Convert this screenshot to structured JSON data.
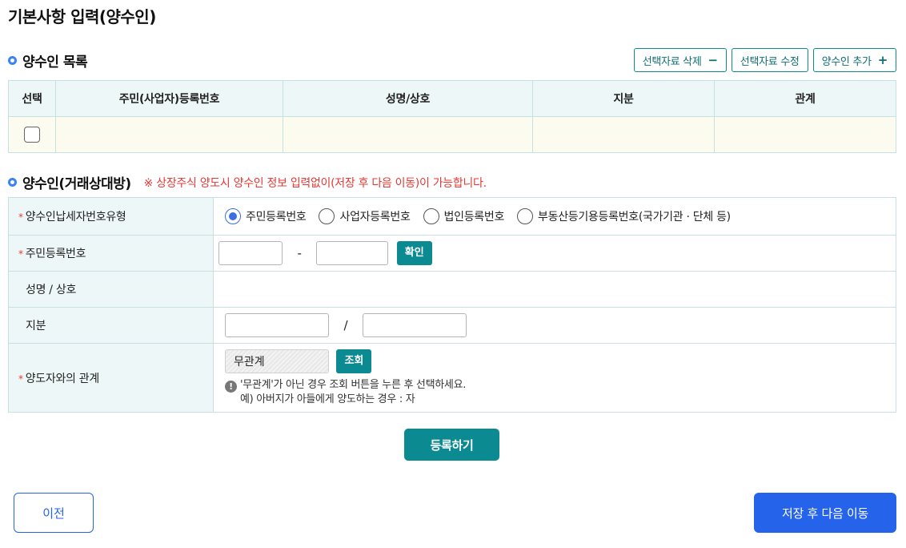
{
  "page": {
    "title": "기본사항 입력(양수인)"
  },
  "list_section": {
    "title": "양수인 목록",
    "buttons": {
      "delete_label": "선택자료 삭제",
      "delete_symbol": "−",
      "edit_label": "선택자료 수정",
      "add_label": "양수인 추가",
      "add_symbol": "+"
    },
    "columns": [
      "선택",
      "주민(사업자)등록번호",
      "성명/상호",
      "지분",
      "관계"
    ]
  },
  "detail_section": {
    "title": "양수인(거래상대방)",
    "notice": "※ 상장주식 양도시 양수인 정보 입력없이(저장 후 다음 이동)이 가능합니다.",
    "rows": {
      "taxpayer_type": {
        "label": "양수인납세자번호유형",
        "options": [
          "주민등록번호",
          "사업자등록번호",
          "법인등록번호",
          "부동산등기용등록번호(국가기관 · 단체 등)"
        ],
        "selected": "주민등록번호"
      },
      "rrn": {
        "label": "주민등록번호",
        "dash": "-",
        "confirm_label": "확인"
      },
      "name": {
        "label": "성명 / 상호"
      },
      "share": {
        "label": "지분",
        "slash": "/"
      },
      "relation": {
        "label": "양도자와의 관계",
        "value": "무관계",
        "lookup_label": "조회",
        "hint_line1": "'무관계'가 아닌 경우 조회 버튼을 누른 후 선택하세요.",
        "hint_line2": "예) 아버지가 아들에게 양도하는 경우 : 자"
      }
    }
  },
  "actions": {
    "register": "등록하기",
    "prev": "이전",
    "save_next": "저장 후 다음 이동"
  },
  "colors": {
    "teal": "#0b8a92",
    "blue": "#2563eb",
    "required": "#e53935"
  },
  "icons": {
    "bullet": "circle-bullet-icon",
    "info": "info-icon"
  }
}
